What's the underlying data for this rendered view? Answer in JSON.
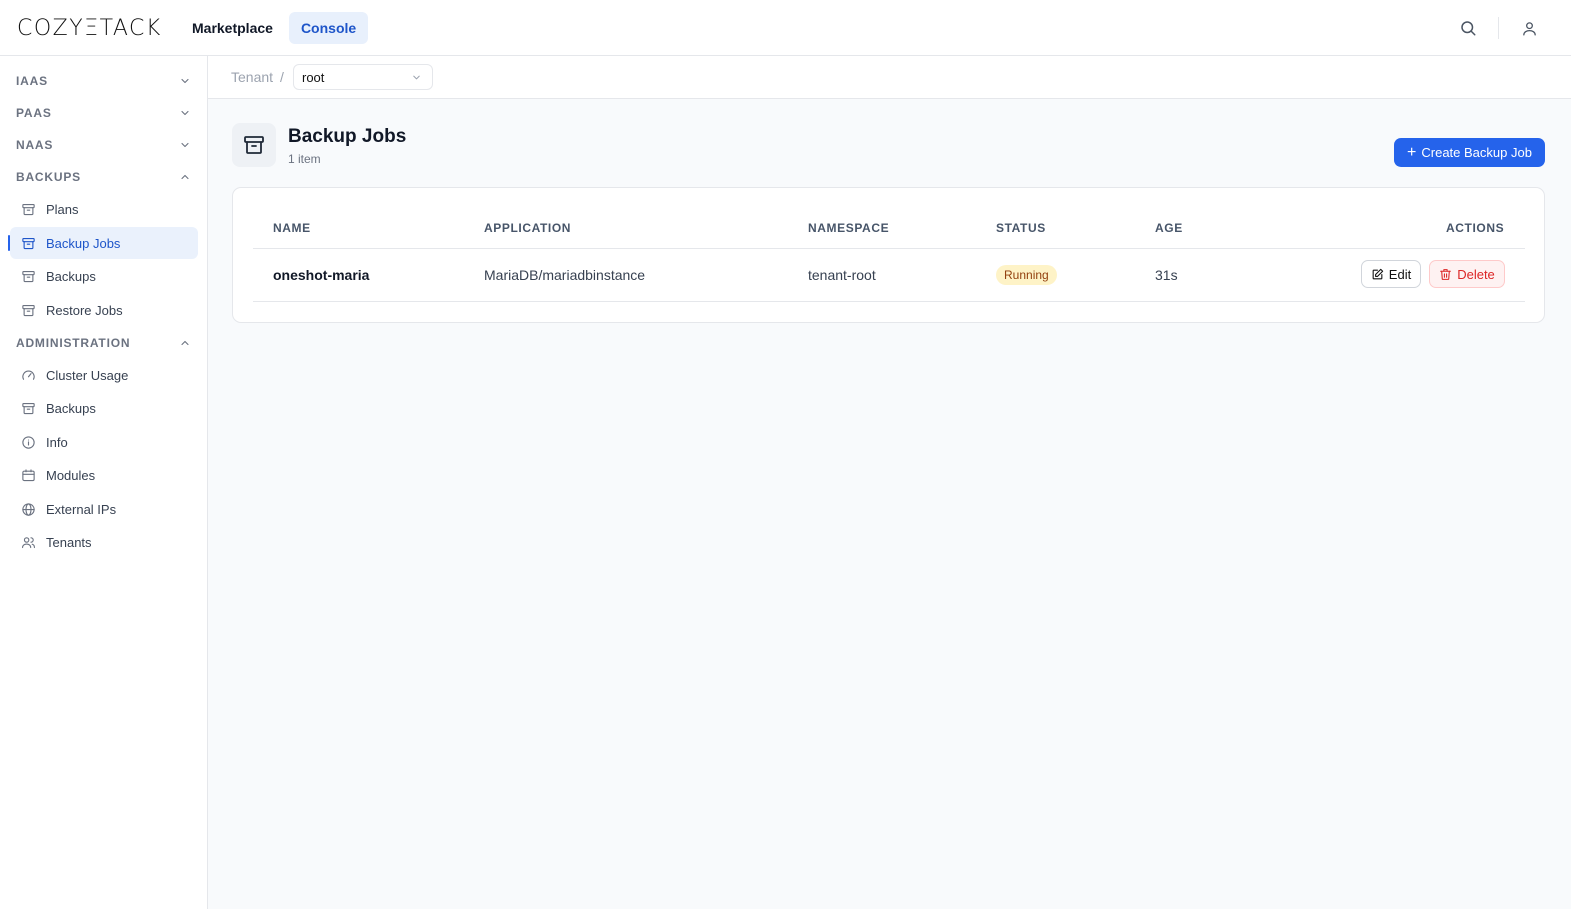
{
  "app": {
    "logo": "COZYΞTACK",
    "nav": [
      {
        "label": "Marketplace",
        "active": false
      },
      {
        "label": "Console",
        "active": true
      }
    ],
    "icons": {
      "search": "search-icon",
      "user": "user-icon"
    }
  },
  "sidebar": {
    "sections": [
      {
        "label": "IAAS",
        "expanded": false
      },
      {
        "label": "PAAS",
        "expanded": false
      },
      {
        "label": "NAAS",
        "expanded": false
      },
      {
        "label": "BACKUPS",
        "expanded": true
      },
      {
        "label": "ADMINISTRATION",
        "expanded": true
      }
    ],
    "backups_items": [
      {
        "label": "Plans",
        "icon": "archive-icon"
      },
      {
        "label": "Backup Jobs",
        "icon": "archive-icon",
        "active": true
      },
      {
        "label": "Backups",
        "icon": "archive-icon"
      },
      {
        "label": "Restore Jobs",
        "icon": "archive-icon"
      }
    ],
    "admin_items": [
      {
        "label": "Cluster Usage",
        "icon": "gauge-icon"
      },
      {
        "label": "Backups",
        "icon": "archive-icon"
      },
      {
        "label": "Info",
        "icon": "info-icon"
      },
      {
        "label": "Modules",
        "icon": "calendar-icon"
      },
      {
        "label": "External IPs",
        "icon": "globe-icon"
      },
      {
        "label": "Tenants",
        "icon": "users-icon"
      }
    ]
  },
  "breadcrumb": {
    "tenant_label": "Tenant",
    "separator": "/",
    "selected": "root"
  },
  "page": {
    "title": "Backup Jobs",
    "count": "1 item",
    "create_label": "Create Backup Job"
  },
  "table": {
    "columns": [
      "NAME",
      "APPLICATION",
      "NAMESPACE",
      "STATUS",
      "AGE",
      "ACTIONS"
    ],
    "rows": [
      {
        "name": "oneshot-maria",
        "application": "MariaDB/mariadbinstance",
        "namespace": "tenant-root",
        "status": "Running",
        "age": "31s",
        "edit_label": "Edit",
        "delete_label": "Delete"
      }
    ]
  },
  "colors": {
    "accent": "#2563eb",
    "active_bg": "#eaf1fc",
    "status_running_bg": "#fef3c7",
    "danger": "#dc2626"
  }
}
